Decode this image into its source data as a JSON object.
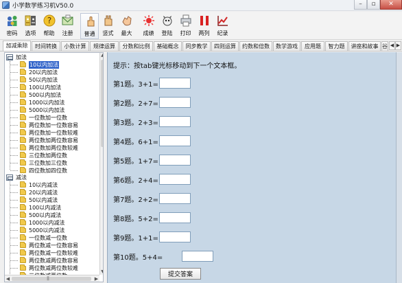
{
  "window": {
    "title": "小学数学练习机V50.0",
    "minimize": "–",
    "restore": "▫",
    "close": "✕"
  },
  "toolbar": {
    "items": [
      {
        "label": "密码",
        "icon": "key-people-icon"
      },
      {
        "label": "选项",
        "icon": "options-icon"
      },
      {
        "label": "帮助",
        "icon": "help-icon"
      },
      {
        "label": "注册",
        "icon": "register-icon"
      },
      {
        "label": "普通",
        "icon": "hand-point-icon"
      },
      {
        "label": "竖式",
        "icon": "hand-open-icon"
      },
      {
        "label": "最大",
        "icon": "hand-grab-icon"
      },
      {
        "label": "成绩",
        "icon": "score-icon"
      },
      {
        "label": "登陆",
        "icon": "login-icon"
      },
      {
        "label": "打印",
        "icon": "printer-icon"
      },
      {
        "label": "两列",
        "icon": "two-columns-icon"
      },
      {
        "label": "纪录",
        "icon": "chart-record-icon"
      }
    ]
  },
  "tabs": [
    {
      "label": "加减乘除",
      "active": true
    },
    {
      "label": "时间转换"
    },
    {
      "label": "小数计算"
    },
    {
      "label": "规律运算"
    },
    {
      "label": "分数和比例"
    },
    {
      "label": "基础概念"
    },
    {
      "label": "同步教学"
    },
    {
      "label": "四则运算"
    },
    {
      "label": "约数和倍数"
    },
    {
      "label": "数学游戏"
    },
    {
      "label": "应用题"
    },
    {
      "label": "智力题"
    },
    {
      "label": "讲座和故事"
    },
    {
      "label": "谷歌"
    }
  ],
  "tree": {
    "groups": [
      {
        "label": "加法",
        "items": [
          "10以内加法",
          "20以内加法",
          "50以内加法",
          "100以内加法",
          "500以内加法",
          "1000以内加法",
          "5000以内加法",
          "一位数加一位数",
          "两位数加一位数容易",
          "两位数加一位数较难",
          "两位数加两位数容易",
          "两位数加两位数较难",
          "三位数加两位数",
          "三位数加三位数",
          "四位数加四位数"
        ]
      },
      {
        "label": "减法",
        "items": [
          "10以内减法",
          "20以内减法",
          "50以内减法",
          "100以内减法",
          "500以内减法",
          "1000以内减法",
          "5000以内减法",
          "一位数减一位数",
          "两位数减一位数容易",
          "两位数减一位数较难",
          "两位数减两位数容易",
          "两位数减两位数较难",
          "三位数减两位数"
        ]
      }
    ],
    "selected": "10以内加法"
  },
  "main": {
    "hint": "提示：按tab键光标移动到下一个文本框。",
    "questions": [
      {
        "label": "第1题。3+1=",
        "value": ""
      },
      {
        "label": "第2题。2+7=",
        "value": ""
      },
      {
        "label": "第3题。2+3=",
        "value": ""
      },
      {
        "label": "第4题。6+1=",
        "value": ""
      },
      {
        "label": "第5题。1+7=",
        "value": ""
      },
      {
        "label": "第6题。2+4=",
        "value": ""
      },
      {
        "label": "第7题。2+2=",
        "value": ""
      },
      {
        "label": "第8题。5+2=",
        "value": ""
      },
      {
        "label": "第9题。1+1=",
        "value": ""
      },
      {
        "label": "第10题。5+4=",
        "value": ""
      }
    ],
    "submit_label": "提交答案"
  }
}
